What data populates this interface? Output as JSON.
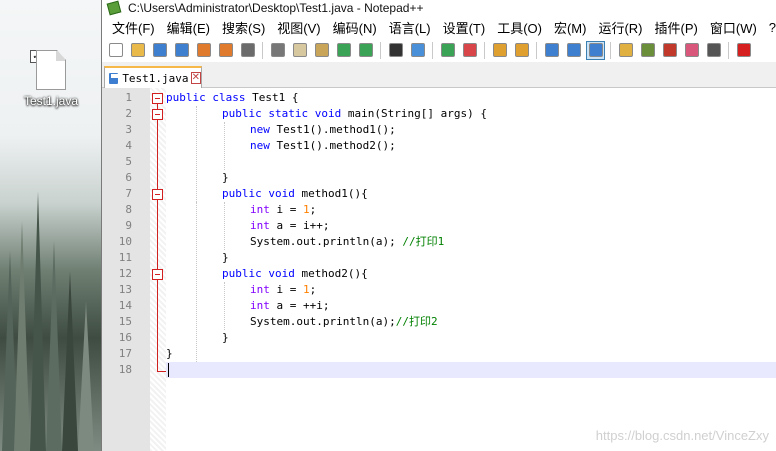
{
  "desktop": {
    "file_icon_label": "Test1.java",
    "checkbox_glyph": "✓"
  },
  "window": {
    "title": "C:\\Users\\Administrator\\Desktop\\Test1.java - Notepad++"
  },
  "menu": [
    "文件(F)",
    "编辑(E)",
    "搜索(S)",
    "视图(V)",
    "编码(N)",
    "语言(L)",
    "设置(T)",
    "工具(O)",
    "宏(M)",
    "运行(R)",
    "插件(P)",
    "窗口(W)",
    "?"
  ],
  "toolbar_icons": [
    {
      "name": "new-file-icon",
      "color": "#ffffff"
    },
    {
      "name": "open-folder-icon",
      "color": "#e9b949"
    },
    {
      "name": "save-icon",
      "color": "#3f7fcf"
    },
    {
      "name": "save-all-icon",
      "color": "#3f7fcf"
    },
    {
      "name": "close-icon",
      "color": "#e07a2c"
    },
    {
      "name": "close-all-icon",
      "color": "#e07a2c"
    },
    {
      "name": "print-icon",
      "color": "#6b6b6b"
    },
    {
      "name": "cut-icon",
      "color": "#777777"
    },
    {
      "name": "copy-icon",
      "color": "#d8c8a0"
    },
    {
      "name": "paste-icon",
      "color": "#c9a55a"
    },
    {
      "name": "undo-icon",
      "color": "#3aa356"
    },
    {
      "name": "redo-icon",
      "color": "#3aa356"
    },
    {
      "name": "find-icon",
      "color": "#333333"
    },
    {
      "name": "replace-icon",
      "color": "#4a90d9"
    },
    {
      "name": "zoom-in-icon",
      "color": "#3aa356"
    },
    {
      "name": "zoom-out-icon",
      "color": "#d9464a"
    },
    {
      "name": "sync-vertical-icon",
      "color": "#e0a030"
    },
    {
      "name": "sync-horizontal-icon",
      "color": "#e0a030"
    },
    {
      "name": "word-wrap-icon",
      "color": "#3f7fcf"
    },
    {
      "name": "show-all-chars-icon",
      "color": "#3f7fcf"
    },
    {
      "name": "indent-guide-icon",
      "color": "#3f7fcf"
    },
    {
      "name": "user-lang-icon",
      "color": "#e0b040"
    },
    {
      "name": "doc-map-icon",
      "color": "#6b8e3a"
    },
    {
      "name": "function-list-icon",
      "color": "#c0392b"
    },
    {
      "name": "folder-workspace-icon",
      "color": "#d9577a"
    },
    {
      "name": "monitoring-icon",
      "color": "#555555"
    },
    {
      "name": "record-macro-icon",
      "color": "#d62020"
    }
  ],
  "tab": {
    "label": "Test1.java",
    "close_glyph": "✕"
  },
  "editor": {
    "line_numbers": [
      "1",
      "2",
      "3",
      "4",
      "5",
      "6",
      "7",
      "8",
      "9",
      "10",
      "11",
      "12",
      "13",
      "14",
      "15",
      "16",
      "17",
      "18"
    ],
    "current_line": 18
  },
  "code": {
    "l1_kw1": "public",
    "l1_kw2": "class",
    "l1_text": " Test1 {",
    "l2_kw1": "public",
    "l2_kw2": "static",
    "l2_kw3": "void",
    "l2_text": " main(String[] args) {",
    "l3_kw": "new",
    "l3_text": " Test1().method1();",
    "l4_kw": "new",
    "l4_text": " Test1().method2();",
    "l6_text": "}",
    "l7_kw1": "public",
    "l7_kw2": "void",
    "l7_text": " method1(){",
    "l8_kw": "int",
    "l8_text": " i = ",
    "l8_num": "1",
    "l8_end": ";",
    "l9_kw": "int",
    "l9_text": " a = i++;",
    "l10_text": "System.out.println(a); ",
    "l10_cm": "//打印1",
    "l11_text": "}",
    "l12_kw1": "public",
    "l12_kw2": "void",
    "l12_text": " method2(){",
    "l13_kw": "int",
    "l13_text": " i = ",
    "l13_num": "1",
    "l13_end": ";",
    "l14_kw": "int",
    "l14_text": " a = ++i;",
    "l15_text": "System.out.println(a);",
    "l15_cm": "//打印2",
    "l16_text": "}",
    "l17_text": "}"
  },
  "watermark": "https://blog.csdn.net/VinceZxy"
}
